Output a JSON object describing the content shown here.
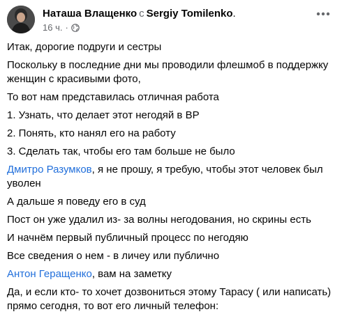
{
  "post": {
    "author": "Наташа Влащенко",
    "with_word": "с",
    "co_author": "Sergiy Tomilenko",
    "time": "16 ч.",
    "dot": "·",
    "privacy_icon": "globe-icon",
    "more_icon": "more-icon"
  },
  "body": {
    "p1": "Итак, дорогие подруги и сестры",
    "p2": "Поскольку в последние дни мы проводили флешмоб в поддержку женщин с красивыми фото,",
    "p3": "То вот нам представилась отличная работа",
    "p4": "1. Узнать, что делает этот негодяй в ВР",
    "p5": "2. Понять, кто нанял его на работу",
    "p6": "3. Сделать так, чтобы его там больше не было",
    "p7_mention": "Дмитро Разумков",
    "p7_text": ", я не прошу, я требую, чтобы этот человек был уволен",
    "p8": "А дальше я поведу его в суд",
    "p9": "Пост он уже удалил из- за волны негодования, но скрины есть",
    "p10": "И начнём первый публичный процесс по негодяю",
    "p11": "Все сведения о нем - в личеу или публично",
    "p12_mention": "Антон Геращенко",
    "p12_text": ", вам на заметку",
    "p13": "Да, и если кто- то хочет дозвониться этому Тарасу ( или написать) прямо сегодня, то вот его личный телефон:"
  },
  "colors": {
    "text": "#050505",
    "secondary": "#65676b",
    "link": "#216fdb"
  }
}
